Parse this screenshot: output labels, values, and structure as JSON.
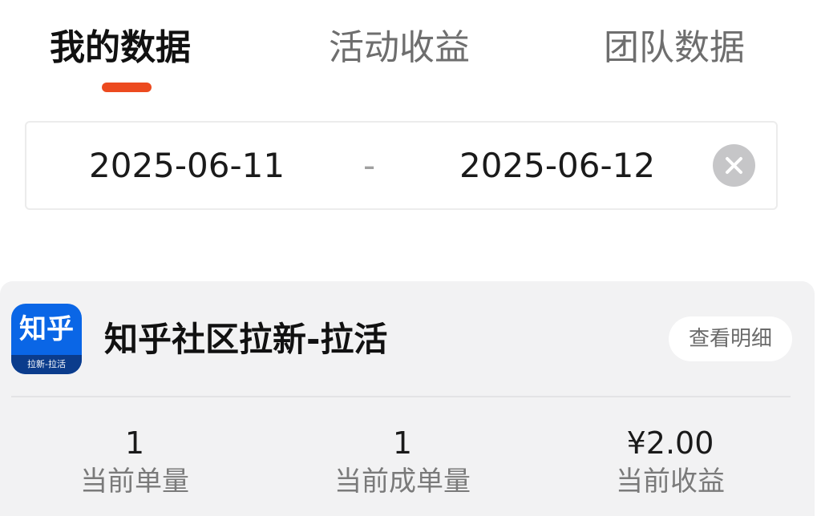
{
  "tabs": [
    {
      "label": "我的数据",
      "active": true
    },
    {
      "label": "活动收益",
      "active": false
    },
    {
      "label": "团队数据",
      "active": false
    }
  ],
  "date_range": {
    "start": "2025-06-11",
    "separator": "-",
    "end": "2025-06-12",
    "clear_icon": "close-circle-icon"
  },
  "activity": {
    "icon_text": "知乎",
    "icon_subtext": "拉新-拉活",
    "title": "知乎社区拉新-拉活",
    "detail_button": "查看明细",
    "stats": [
      {
        "value": "1",
        "label": "当前单量"
      },
      {
        "value": "1",
        "label": "当前成单量"
      },
      {
        "value": "¥2.00",
        "label": "当前收益"
      }
    ]
  },
  "colors": {
    "accent": "#ec4a1f",
    "brand_blue": "#0a66e6"
  }
}
